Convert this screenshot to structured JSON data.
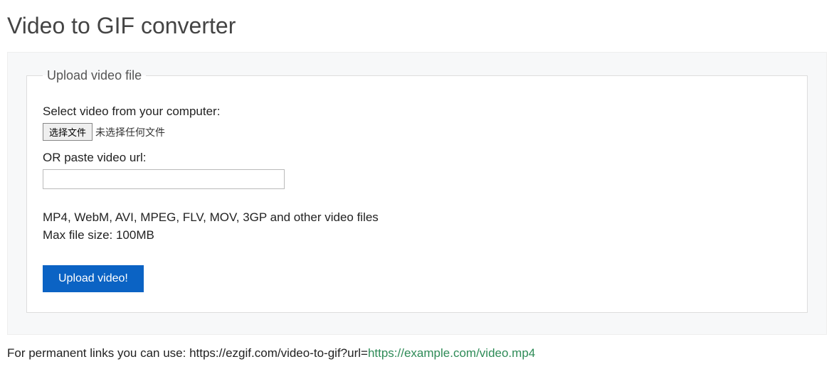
{
  "title": "Video to GIF converter",
  "panel": {
    "legend": "Upload video file",
    "select_label": "Select video from your computer:",
    "file_button": "选择文件",
    "file_status": "未选择任何文件",
    "or_label": "OR paste video url:",
    "url_value": "",
    "formats_note": "MP4, WebM, AVI, MPEG, FLV, MOV, 3GP and other video files",
    "size_note": "Max file size: 100MB",
    "submit_label": "Upload video!"
  },
  "footer": {
    "prefix": "For permanent links you can use: ",
    "base_url": "https://ezgif.com/video-to-gif?url=",
    "example_url": "https://example.com/video.mp4"
  }
}
